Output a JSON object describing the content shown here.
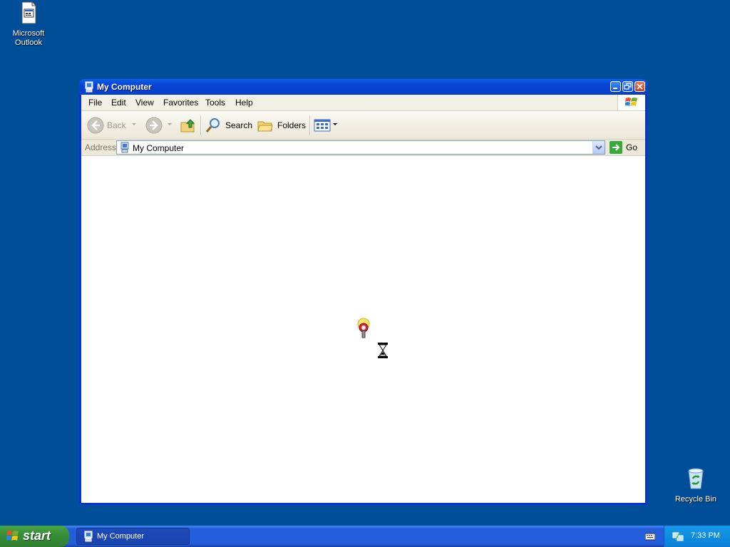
{
  "desktop": {
    "icons": [
      {
        "label": "Microsoft Outlook",
        "icon": "outlook-file-icon"
      },
      {
        "label": "Recycle Bin",
        "icon": "recycle-bin-icon"
      }
    ],
    "background_color": "#004e98"
  },
  "window": {
    "title": "My Computer",
    "title_icon": "computer-icon",
    "controls": [
      "minimize",
      "maximize",
      "close"
    ],
    "menu": [
      "File",
      "Edit",
      "View",
      "Favorites",
      "Tools",
      "Help"
    ],
    "toolbar": {
      "back_label": "Back",
      "search_label": "Search",
      "folders_label": "Folders"
    },
    "address": {
      "label": "Address",
      "value": "My Computer",
      "go_label": "Go"
    }
  },
  "taskbar": {
    "start_label": "start",
    "tasks": [
      {
        "label": "My Computer",
        "icon": "computer-icon"
      }
    ],
    "clock": "7:33 PM"
  }
}
